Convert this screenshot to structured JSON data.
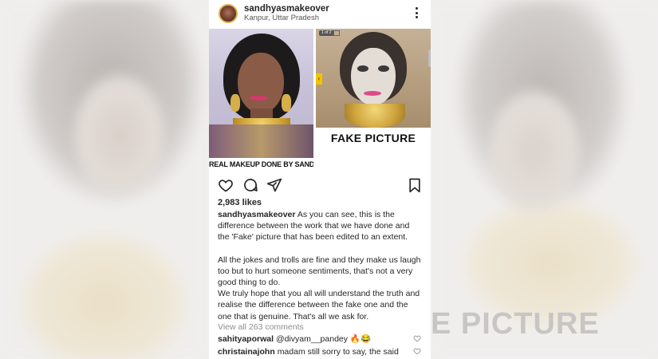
{
  "post": {
    "username": "sandhyasmakeover",
    "location": "Kanpur, Uttar Pradesh",
    "image": {
      "left_label": "REAL MAKEUP DONE BY SANDHYA",
      "right_label": "FAKE PICTURE",
      "chip": "1 of 2"
    },
    "likes": "2,983 likes",
    "caption": {
      "user": "sandhyasmakeover",
      "para1": "As you can see, this is the difference between the work that we have done and the 'Fake' picture that has been edited to an extent.",
      "para2": "All the jokes and trolls are fine and they make us laugh too but to hurt someone sentiments, that's not a very good thing to do.",
      "para3": "We truly hope that you all will understand the truth and realise the difference between the fake one and the one that is genuine. That's all we ask for."
    },
    "view_all": "View all 263 comments",
    "comments": [
      {
        "user": "sahityaporwal",
        "text": "@divyam__pandey 🔥😂"
      },
      {
        "user": "christainajohn",
        "text": "madam still sorry to say, the said"
      }
    ]
  },
  "background": {
    "text": "E PICTURE"
  },
  "icons": {
    "more": "more-vertical-icon",
    "like": "heart-icon",
    "comment": "comment-icon",
    "share": "share-icon",
    "save": "bookmark-icon"
  }
}
